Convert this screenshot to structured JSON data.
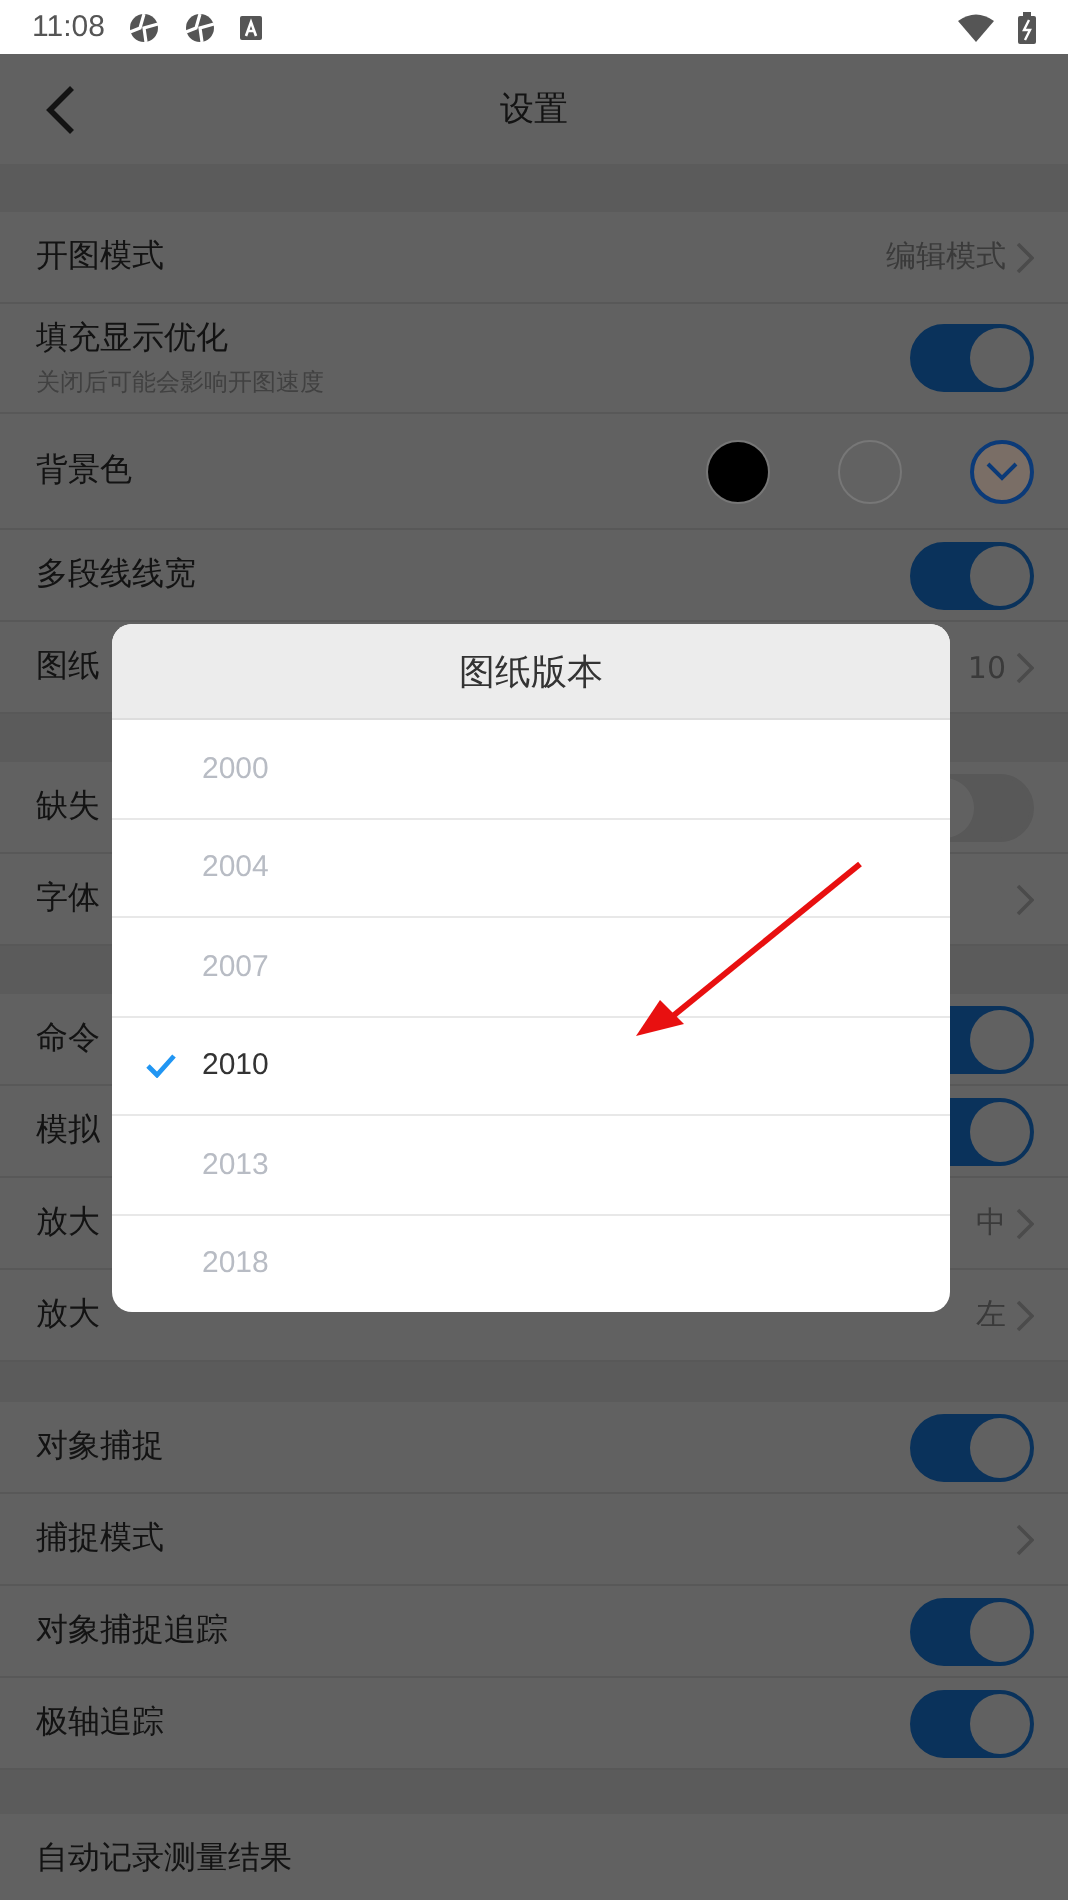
{
  "status_bar": {
    "time": "11:08"
  },
  "header": {
    "title": "设置"
  },
  "sections": [
    {
      "rows": [
        {
          "kind": "link",
          "label": "开图模式",
          "value": "编辑模式"
        },
        {
          "kind": "toggle",
          "label": "填充显示优化",
          "subtitle": "关闭后可能会影响开图速度",
          "on": true
        },
        {
          "kind": "colors",
          "label": "背景色",
          "swatches": [
            {
              "color": "#000000",
              "selected": false
            },
            {
              "color": "#626262",
              "selected": false
            },
            {
              "color": "#7a6e66",
              "selected": true
            }
          ]
        },
        {
          "kind": "toggle",
          "label": "多段线线宽",
          "on": true
        },
        {
          "kind": "link",
          "label": "图纸",
          "value": "10"
        }
      ]
    },
    {
      "rows": [
        {
          "kind": "toggle",
          "label": "缺失",
          "on": false
        },
        {
          "kind": "link",
          "label": "字体"
        }
      ]
    },
    {
      "rows": [
        {
          "kind": "toggle",
          "label": "命令",
          "on": true
        },
        {
          "kind": "toggle",
          "label": "模拟",
          "on": true
        },
        {
          "kind": "link",
          "label": "放大",
          "value": "中"
        },
        {
          "kind": "link",
          "label": "放大",
          "value": "左"
        }
      ]
    },
    {
      "rows": [
        {
          "kind": "toggle",
          "label": "对象捕捉",
          "on": true
        },
        {
          "kind": "link",
          "label": "捕捉模式"
        },
        {
          "kind": "toggle",
          "label": "对象捕捉追踪",
          "on": true
        },
        {
          "kind": "toggle",
          "label": "极轴追踪",
          "on": true
        }
      ]
    },
    {
      "rows": [
        {
          "kind": "plain",
          "label": "自动记录测量结果"
        }
      ]
    }
  ],
  "dialog": {
    "title": "图纸版本",
    "options": [
      {
        "label": "2000",
        "selected": false
      },
      {
        "label": "2004",
        "selected": false
      },
      {
        "label": "2007",
        "selected": false
      },
      {
        "label": "2010",
        "selected": true
      },
      {
        "label": "2013",
        "selected": false
      },
      {
        "label": "2018",
        "selected": false
      }
    ]
  }
}
